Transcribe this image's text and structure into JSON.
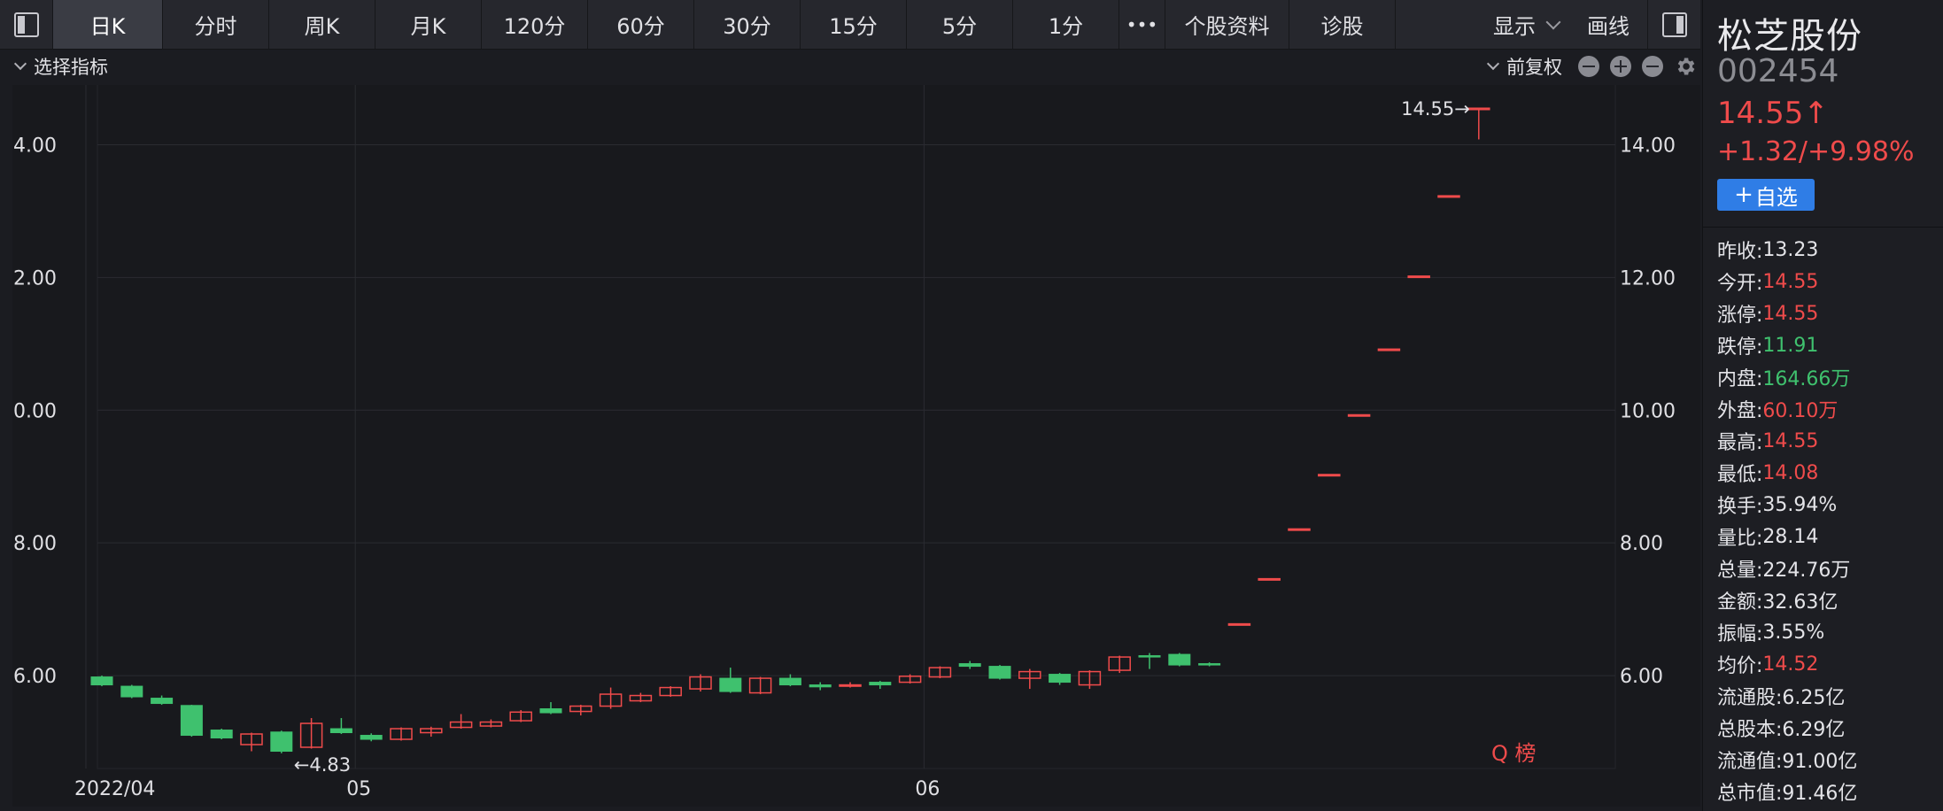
{
  "toolbar": {
    "tabs": [
      {
        "label": "日K",
        "active": true
      },
      {
        "label": "分时"
      },
      {
        "label": "周K"
      },
      {
        "label": "月K"
      },
      {
        "label": "120分"
      },
      {
        "label": "60分"
      },
      {
        "label": "30分"
      },
      {
        "label": "15分"
      },
      {
        "label": "5分"
      },
      {
        "label": "1分"
      },
      {
        "label": "•••"
      },
      {
        "label": "个股资料"
      },
      {
        "label": "诊股"
      }
    ],
    "display_label": "显示",
    "draw_label": "画线"
  },
  "subbar": {
    "indicator_label": "选择指标",
    "adjust_label": "前复权"
  },
  "stock": {
    "name": "松芝股份",
    "code": "002454",
    "price": "14.55↑",
    "change": "+1.32/+9.98%",
    "add_watch_label": "自选"
  },
  "stats": [
    {
      "label": "昨收:",
      "value": "13.23",
      "tone": "neutral"
    },
    {
      "label": "今开:",
      "value": "14.55",
      "tone": "up"
    },
    {
      "label": "涨停:",
      "value": "14.55",
      "tone": "up"
    },
    {
      "label": "跌停:",
      "value": "11.91",
      "tone": "down"
    },
    {
      "label": "内盘:",
      "value": "164.66万",
      "tone": "down"
    },
    {
      "label": "外盘:",
      "value": "60.10万",
      "tone": "up"
    },
    {
      "label": "最高:",
      "value": "14.55",
      "tone": "up"
    },
    {
      "label": "最低:",
      "value": "14.08",
      "tone": "up"
    },
    {
      "label": "换手:",
      "value": "35.94%",
      "tone": "neutral"
    },
    {
      "label": "量比:",
      "value": "28.14",
      "tone": "neutral"
    },
    {
      "label": "总量:",
      "value": "224.76万",
      "tone": "neutral"
    },
    {
      "label": "金额:",
      "value": "32.63亿",
      "tone": "neutral"
    },
    {
      "label": "振幅:",
      "value": "3.55%",
      "tone": "neutral"
    },
    {
      "label": "均价:",
      "value": "14.52",
      "tone": "up"
    },
    {
      "label": "流通股:",
      "value": "6.25亿",
      "tone": "neutral"
    },
    {
      "label": "总股本:",
      "value": "6.29亿",
      "tone": "neutral"
    },
    {
      "label": "流通值:",
      "value": "91.00亿",
      "tone": "neutral"
    },
    {
      "label": "总市值:",
      "value": "91.46亿",
      "tone": "neutral"
    }
  ],
  "colors": {
    "up": "#ef4b4b",
    "down": "#3fc16e",
    "accent": "#2f7de6",
    "grid": "#2a2b31",
    "axis_text": "#e0e0e4"
  },
  "chart_data": {
    "type": "candlestick",
    "ylim": [
      4.6,
      14.9
    ],
    "y_ticks": [
      "14.00",
      "12.00",
      "10.00",
      "8.00",
      "6.00"
    ],
    "y_tick_values": [
      14,
      12,
      10,
      8,
      6
    ],
    "x_labels": [
      {
        "text": "2022/04",
        "index": 0
      },
      {
        "text": "05",
        "index": 9
      },
      {
        "text": "06",
        "index": 28
      }
    ],
    "annotations": [
      {
        "text": "14.55→",
        "index": 46,
        "value": 14.55,
        "anchor": "max"
      },
      {
        "text": "←4.83",
        "index": 6,
        "value": 4.83,
        "anchor": "min"
      }
    ],
    "watermark": "Q 榜",
    "candles": [
      {
        "o": 5.98,
        "c": 5.86,
        "h": 6.0,
        "l": 5.84
      },
      {
        "o": 5.84,
        "c": 5.68,
        "h": 5.86,
        "l": 5.66
      },
      {
        "o": 5.66,
        "c": 5.58,
        "h": 5.7,
        "l": 5.56
      },
      {
        "o": 5.55,
        "c": 5.1,
        "h": 5.56,
        "l": 5.08
      },
      {
        "o": 5.18,
        "c": 5.06,
        "h": 5.2,
        "l": 5.04
      },
      {
        "o": 4.96,
        "c": 5.12,
        "h": 5.14,
        "l": 4.86
      },
      {
        "o": 5.15,
        "c": 4.86,
        "h": 5.17,
        "l": 4.83
      },
      {
        "o": 4.92,
        "c": 5.28,
        "h": 5.36,
        "l": 4.9
      },
      {
        "o": 5.2,
        "c": 5.14,
        "h": 5.36,
        "l": 5.12
      },
      {
        "o": 5.1,
        "c": 5.04,
        "h": 5.13,
        "l": 5.01
      },
      {
        "o": 5.04,
        "c": 5.2,
        "h": 5.22,
        "l": 5.02
      },
      {
        "o": 5.14,
        "c": 5.2,
        "h": 5.23,
        "l": 5.08
      },
      {
        "o": 5.22,
        "c": 5.3,
        "h": 5.42,
        "l": 5.2
      },
      {
        "o": 5.24,
        "c": 5.3,
        "h": 5.34,
        "l": 5.22
      },
      {
        "o": 5.32,
        "c": 5.45,
        "h": 5.48,
        "l": 5.3
      },
      {
        "o": 5.5,
        "c": 5.44,
        "h": 5.6,
        "l": 5.42
      },
      {
        "o": 5.46,
        "c": 5.54,
        "h": 5.56,
        "l": 5.4
      },
      {
        "o": 5.54,
        "c": 5.72,
        "h": 5.82,
        "l": 5.5
      },
      {
        "o": 5.62,
        "c": 5.7,
        "h": 5.74,
        "l": 5.6
      },
      {
        "o": 5.7,
        "c": 5.82,
        "h": 5.84,
        "l": 5.68
      },
      {
        "o": 5.8,
        "c": 5.98,
        "h": 6.02,
        "l": 5.76
      },
      {
        "o": 5.96,
        "c": 5.76,
        "h": 6.12,
        "l": 5.74
      },
      {
        "o": 5.74,
        "c": 5.96,
        "h": 5.98,
        "l": 5.72
      },
      {
        "o": 5.96,
        "c": 5.86,
        "h": 6.02,
        "l": 5.84
      },
      {
        "o": 5.86,
        "c": 5.83,
        "h": 5.9,
        "l": 5.78
      },
      {
        "o": 5.84,
        "c": 5.86,
        "h": 5.9,
        "l": 5.82
      },
      {
        "o": 5.9,
        "c": 5.86,
        "h": 5.92,
        "l": 5.8
      },
      {
        "o": 5.9,
        "c": 5.99,
        "h": 6.02,
        "l": 5.88
      },
      {
        "o": 5.98,
        "c": 6.12,
        "h": 6.14,
        "l": 5.96
      },
      {
        "o": 6.18,
        "c": 6.14,
        "h": 6.22,
        "l": 6.1
      },
      {
        "o": 6.14,
        "c": 5.96,
        "h": 6.16,
        "l": 5.94
      },
      {
        "o": 5.96,
        "c": 6.06,
        "h": 6.1,
        "l": 5.8
      },
      {
        "o": 6.02,
        "c": 5.9,
        "h": 6.04,
        "l": 5.86
      },
      {
        "o": 5.86,
        "c": 6.06,
        "h": 6.08,
        "l": 5.8
      },
      {
        "o": 6.08,
        "c": 6.28,
        "h": 6.3,
        "l": 6.04
      },
      {
        "o": 6.3,
        "c": 6.28,
        "h": 6.34,
        "l": 6.1
      },
      {
        "o": 6.32,
        "c": 6.16,
        "h": 6.34,
        "l": 6.14
      },
      {
        "o": 6.18,
        "c": 6.16,
        "h": 6.2,
        "l": 6.14
      },
      {
        "o": 6.78,
        "c": 6.78,
        "h": 6.78,
        "l": 6.78
      },
      {
        "o": 7.46,
        "c": 7.46,
        "h": 7.46,
        "l": 7.46
      },
      {
        "o": 8.21,
        "c": 8.21,
        "h": 8.21,
        "l": 8.21
      },
      {
        "o": 9.03,
        "c": 9.03,
        "h": 9.03,
        "l": 9.03
      },
      {
        "o": 9.93,
        "c": 9.93,
        "h": 9.93,
        "l": 9.93
      },
      {
        "o": 10.92,
        "c": 10.92,
        "h": 10.92,
        "l": 10.92
      },
      {
        "o": 12.02,
        "c": 12.02,
        "h": 12.02,
        "l": 12.02
      },
      {
        "o": 13.23,
        "c": 13.23,
        "h": 13.23,
        "l": 13.23
      },
      {
        "o": 14.55,
        "c": 14.55,
        "h": 14.55,
        "l": 14.08
      }
    ]
  }
}
